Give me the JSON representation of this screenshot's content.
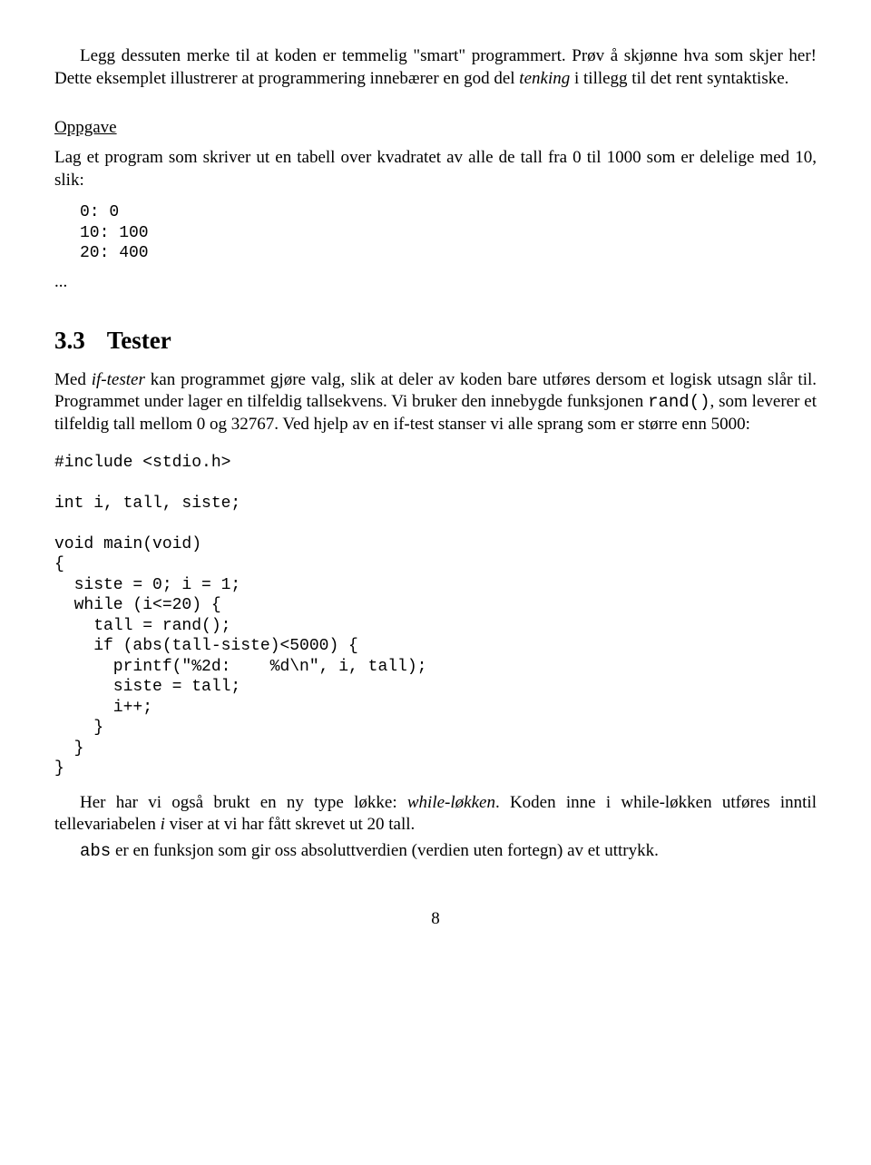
{
  "para1_a": "Legg dessuten merke til at koden er temmelig \"smart\" programmert. Prøv å skjønne hva som skjer her! Dette eksemplet illustrerer at programmering innebærer en god del ",
  "para1_em": "tenking",
  "para1_b": " i tillegg til det rent syntaktiske.",
  "heading_oppgave": "Oppgave",
  "para2": "Lag et program som skriver ut en tabell over kvadratet av alle de tall fra 0 til 1000 som er delelige med 10, slik:",
  "code1": "0: 0\n10: 100\n20: 400",
  "ellipsis": "...",
  "heading_sec_num": "3.3",
  "heading_sec_title": "Tester",
  "para3_a": "Med ",
  "para3_em1": "if-tester",
  "para3_b": " kan programmet gjøre valg, slik at deler av koden bare utføres dersom et logisk utsagn slår til. Programmet under lager en tilfeldig tallsekvens. Vi bruker den innebygde funksjonen ",
  "para3_code": "rand()",
  "para3_c": ", som leverer et tilfeldig tall mellom 0 og 32767. Ved hjelp av en if-test stanser vi alle sprang som er større enn 5000:",
  "code2": "#include <stdio.h>\n\nint i, tall, siste;\n\nvoid main(void)\n{\n  siste = 0; i = 1;\n  while (i<=20) {\n    tall = rand();\n    if (abs(tall-siste)<5000) {\n      printf(\"%2d:    %d\\n\", i, tall);\n      siste = tall;\n      i++;\n    }\n  }\n}",
  "para4_a": "Her har vi også brukt en ny type løkke: ",
  "para4_em1": "while-løkken",
  "para4_b": ". Koden inne i while-løkken utføres inntil tellevariabelen ",
  "para4_em2": "i",
  "para4_c": " viser at vi har fått skrevet ut 20 tall.",
  "para5_code": "abs",
  "para5_a": " er en funksjon som gir oss absoluttverdien (verdien uten fortegn) av et uttrykk.",
  "page_number": "8"
}
